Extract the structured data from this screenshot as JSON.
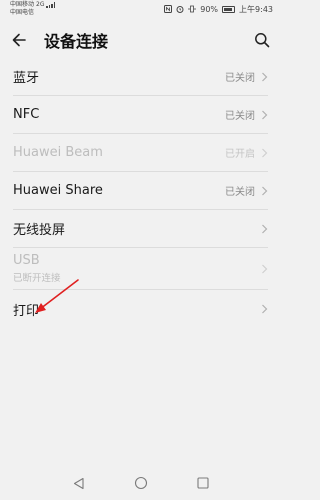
{
  "status_bar": {
    "carrier1": "中国移动",
    "carrier1_net": "2G",
    "carrier2": "中国电信",
    "carrier2_net": "4G",
    "battery": "90%",
    "time": "上午9:43"
  },
  "header": {
    "title": "设备连接",
    "back_icon": "back-arrow-icon",
    "search_icon": "search-icon"
  },
  "items": [
    {
      "label": "蓝牙",
      "value": "已关闭",
      "disabled": false
    },
    {
      "label": "NFC",
      "value": "已关闭",
      "disabled": false
    },
    {
      "label": "Huawei Beam",
      "value": "已开启",
      "disabled": true
    },
    {
      "label": "Huawei Share",
      "value": "已关闭",
      "disabled": false
    },
    {
      "label": "无线投屏",
      "value": "",
      "disabled": false
    },
    {
      "label": "USB",
      "sub": "已断开连接",
      "value": "",
      "disabled": true
    },
    {
      "label": "打印",
      "value": "",
      "disabled": false
    }
  ],
  "nav": {
    "back": "nav-back-icon",
    "home": "nav-home-icon",
    "recents": "nav-recents-icon"
  },
  "colors": {
    "background": "#f1f1f1",
    "annotation_arrow": "#e02020"
  }
}
